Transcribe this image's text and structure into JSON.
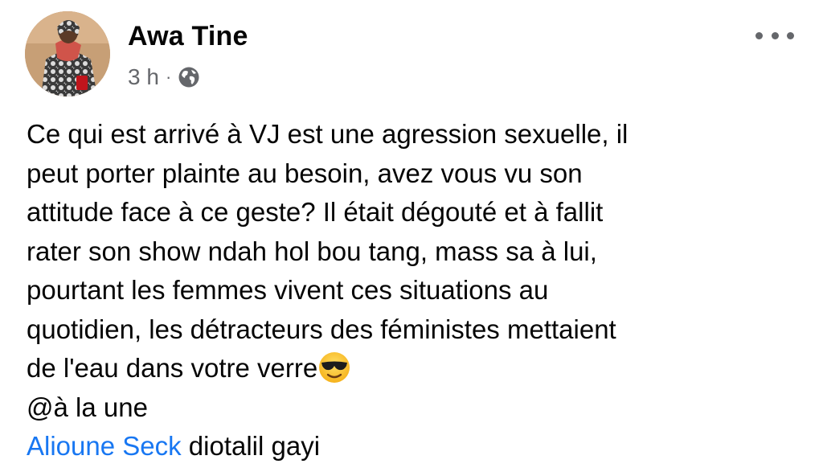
{
  "post": {
    "author_name": "Awa Tine",
    "timestamp": "3 h",
    "separator": "·",
    "privacy_icon": "globe-icon",
    "more_icon": "more-horizontal-icon",
    "lines": [
      "Ce qui est arrivé à VJ est une agression sexuelle, il",
      "peut porter plainte au besoin, avez vous vu son",
      "attitude face à ce geste? Il était  dégouté et à fallit",
      "rater son show ndah hol bou tang, mass sa à lui,",
      "pourtant les femmes vivent ces situations au",
      "quotidien, les détracteurs des féministes mettaient",
      "de l'eau dans votre verre"
    ],
    "emoji": "smiling-face-with-sunglasses-icon",
    "tag_line": "@à la une",
    "mention_name": "Alioune Seck",
    "mention_suffix": " diotalil gayi"
  },
  "colors": {
    "text": "#050505",
    "secondary_text": "#65676b",
    "link": "#1877f2"
  }
}
